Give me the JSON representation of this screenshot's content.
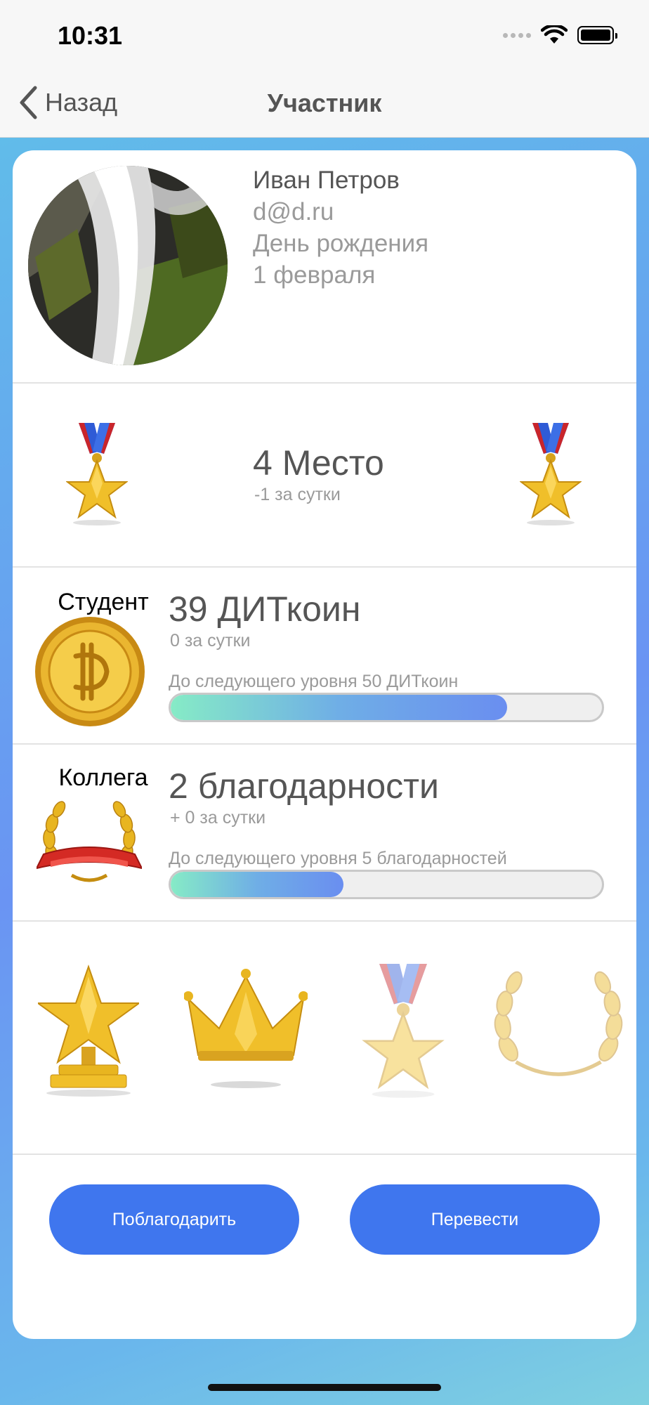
{
  "status_bar": {
    "time": "10:31"
  },
  "nav": {
    "back_label": "Назад",
    "title": "Участник"
  },
  "profile": {
    "name": "Иван Петров",
    "email": "d@d.ru",
    "birthday_label": "День рождения",
    "birthday_value": "1 февраля"
  },
  "place": {
    "title": "4 Место",
    "change": "-1 за сутки"
  },
  "coins": {
    "rank": "Студент",
    "amount": "39 ДИТкоин",
    "change": "0 за сутки",
    "next_level": "До следующего уровня 50 ДИТкоин",
    "progress": 0.78
  },
  "thanks": {
    "rank": "Коллега",
    "amount": "2 благодарности",
    "change": "+ 0 за сутки",
    "next_level": "До следующего уровня 5 благодарностей",
    "progress": 0.4
  },
  "awards": [
    {
      "icon": "trophy-star-icon",
      "earned": true
    },
    {
      "icon": "crown-icon",
      "earned": true
    },
    {
      "icon": "medal-star-icon",
      "earned": false
    },
    {
      "icon": "laurel-wreath-icon",
      "earned": false
    }
  ],
  "buttons": {
    "thank_label": "Поблагодарить",
    "transfer_label": "Перевести"
  },
  "colors": {
    "accent": "#3f76ee",
    "progress_start": "#86ebc6",
    "progress_end": "#6a8ef0",
    "gold": "#e8b520"
  }
}
